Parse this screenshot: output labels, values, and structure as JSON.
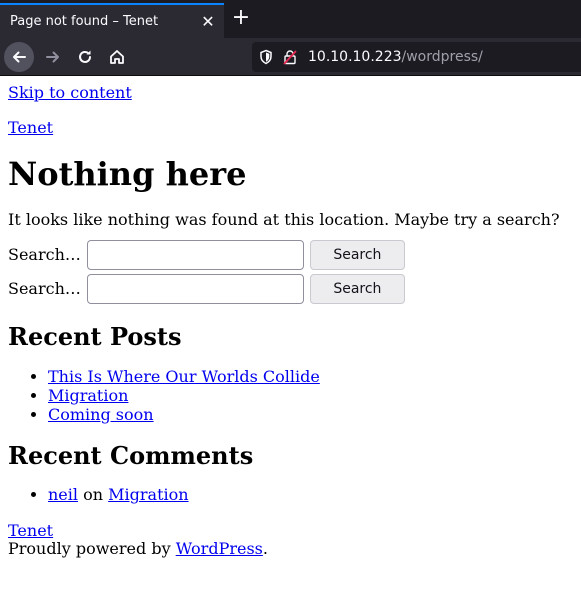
{
  "browser": {
    "tab_title": "Page not found – Tenet",
    "tab_close": "✕",
    "new_tab": "+",
    "url_host": "10.10.10.223",
    "url_path": "/wordpress/"
  },
  "page": {
    "skip_link": "Skip to content",
    "site_title": "Tenet",
    "heading": "Nothing here",
    "message": "It looks like nothing was found at this location. Maybe try a search?",
    "search_forms": [
      {
        "label": "Search…",
        "button": "Search",
        "value": ""
      },
      {
        "label": "Search…",
        "button": "Search",
        "value": ""
      }
    ],
    "recent_posts_title": "Recent Posts",
    "recent_posts": [
      "This Is Where Our Worlds Collide",
      "Migration",
      "Coming soon"
    ],
    "recent_comments_title": "Recent Comments",
    "recent_comments": [
      {
        "author": "neil",
        "on": "on",
        "post": "Migration"
      }
    ],
    "footer_site_title": "Tenet",
    "powered_prefix": "Proudly powered by ",
    "powered_link": "WordPress",
    "powered_suffix": "."
  },
  "colors": {
    "link": "#0000ee",
    "tab_accent": "#0a84ff",
    "chrome_dark": "#1c1b22",
    "chrome": "#2b2a33"
  },
  "icons": [
    "back-arrow-icon",
    "forward-arrow-icon",
    "reload-icon",
    "home-icon",
    "shield-icon",
    "insecure-lock-icon"
  ]
}
